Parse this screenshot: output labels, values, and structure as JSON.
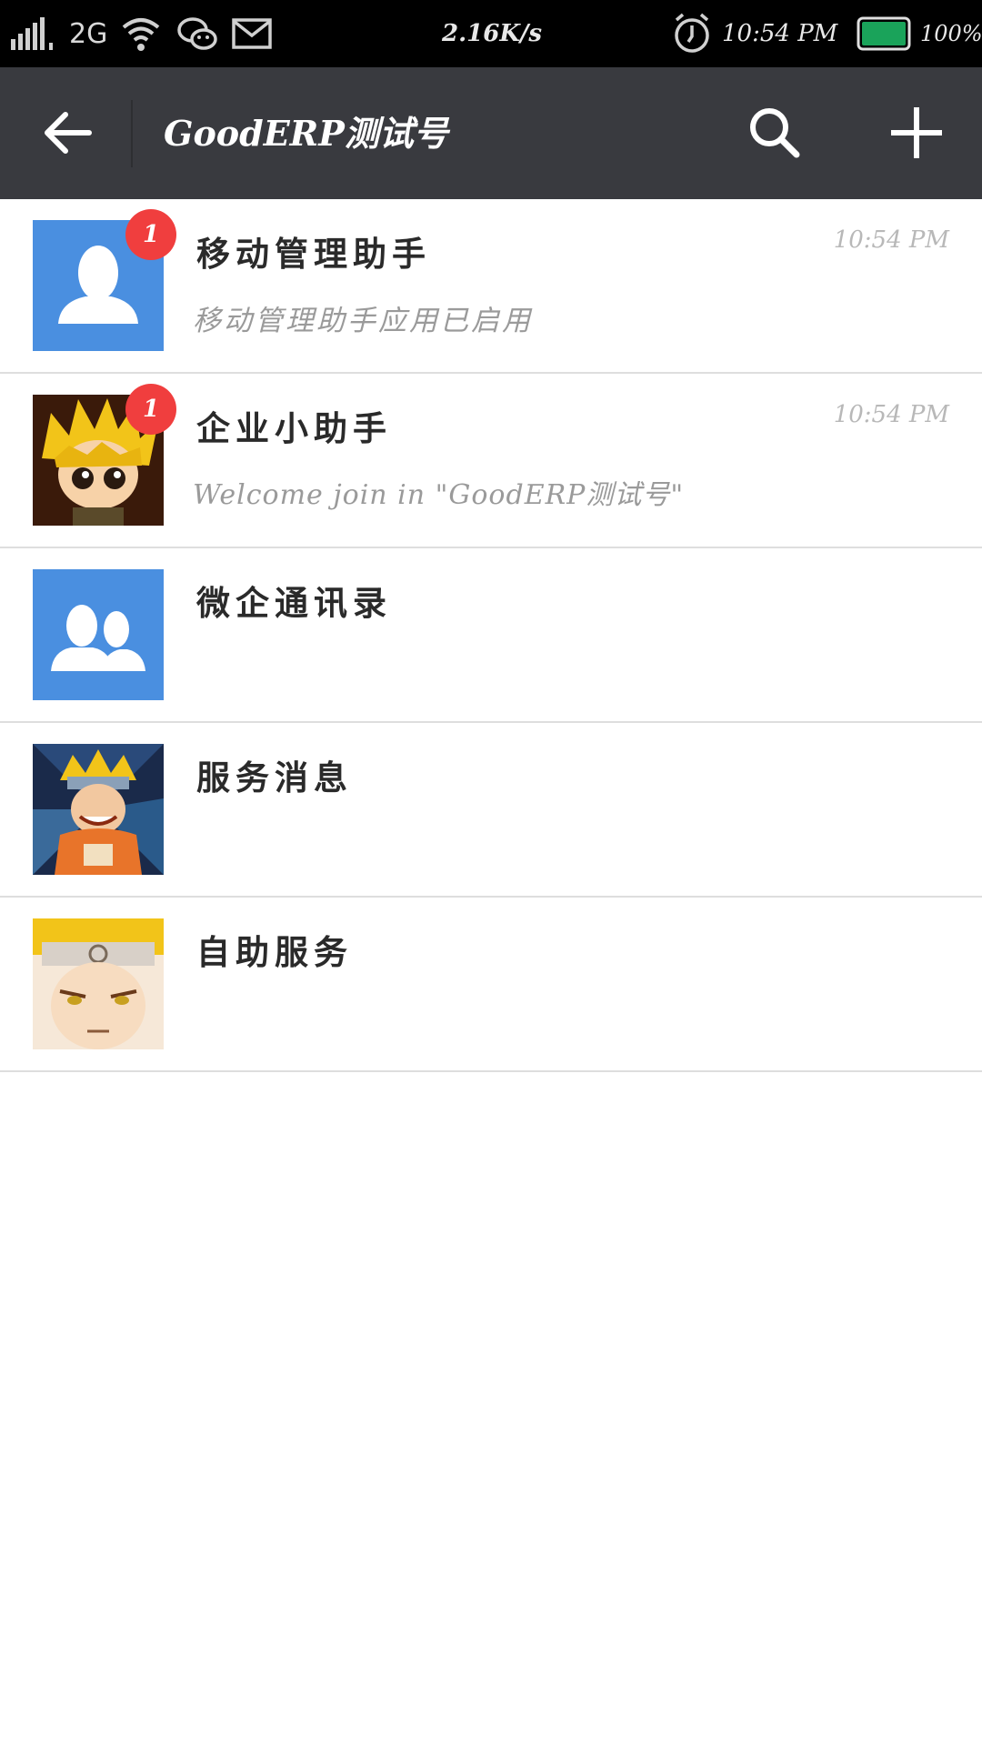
{
  "status_bar": {
    "network_type": "2G",
    "speed": "2.16K/s",
    "time": "10:54 PM",
    "battery": "100%",
    "icons": [
      "signal-icon",
      "wifi-icon",
      "wechat-icon",
      "mail-icon",
      "alarm-icon",
      "battery-icon"
    ]
  },
  "title_bar": {
    "title": "GoodERP测试号",
    "icons": [
      "back-arrow-icon",
      "search-icon",
      "plus-icon"
    ]
  },
  "conversations": [
    {
      "name": "移动管理助手",
      "time": "10:54 PM",
      "preview": "移动管理助手应用已启用",
      "unread": "1",
      "avatar": "person-avatar-icon",
      "avatar_color": "#4a8fe0"
    },
    {
      "name": "企业小助手",
      "time": "10:54 PM",
      "preview": "Welcome join in \"GoodERP测试号\"",
      "unread": "1",
      "avatar": "cartoon-avatar"
    },
    {
      "name": "微企通讯录",
      "avatar": "contacts-avatar-icon",
      "avatar_color": "#4a8fe0"
    },
    {
      "name": "服务消息",
      "avatar": "cartoon-avatar"
    },
    {
      "name": "自助服务",
      "avatar": "cartoon-avatar"
    }
  ],
  "colors": {
    "title_bar_bg": "#393a3f",
    "badge": "#f03e3e",
    "battery": "#1aa35a",
    "avatar_blue": "#4a8fe0"
  }
}
